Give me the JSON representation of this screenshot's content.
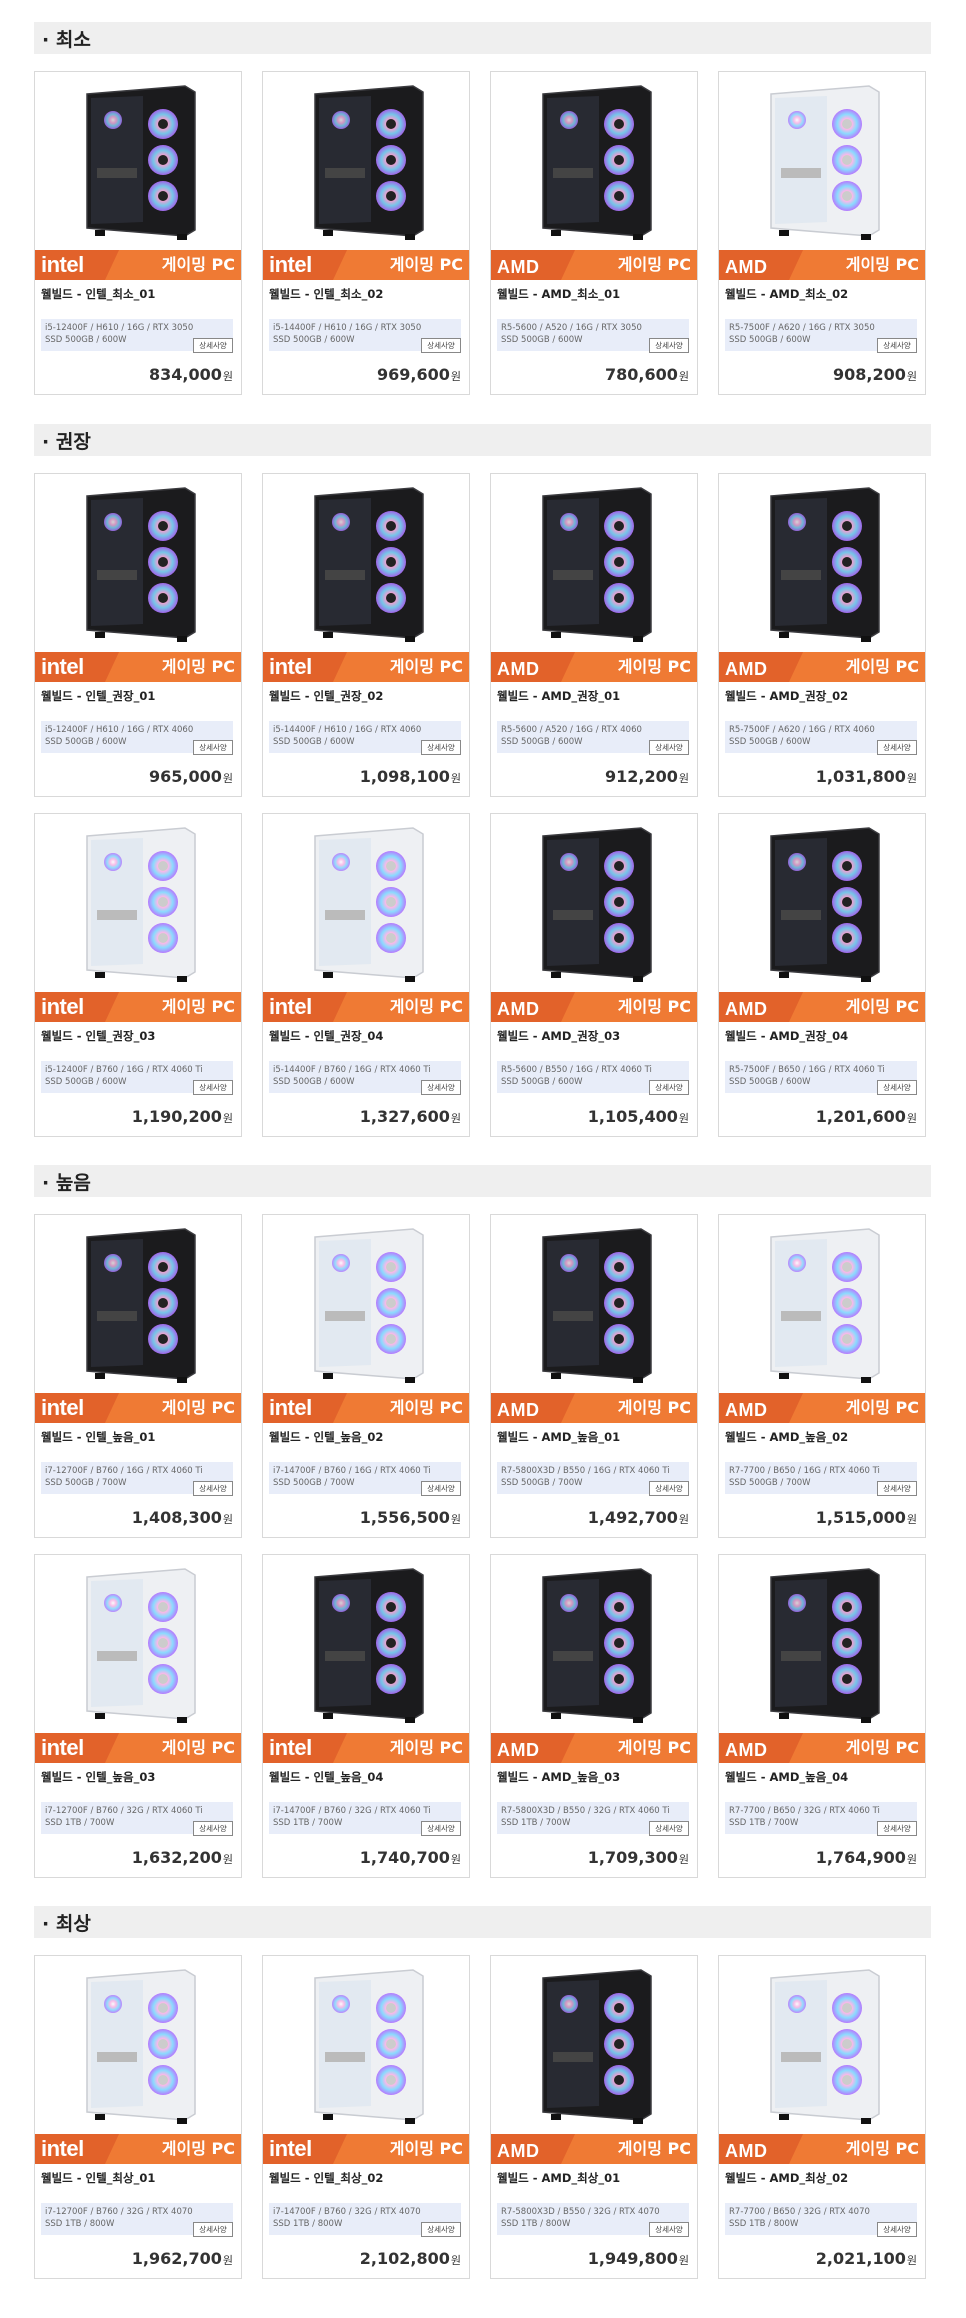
{
  "colors": {
    "banner": "#ef7a34",
    "banner_dark": "#e2622a",
    "spec_bg": "#e8edf9"
  },
  "common": {
    "tag": "게이밍 PC",
    "detail_label": "상세사양",
    "won": "원"
  },
  "sections": [
    {
      "title": "· 최소",
      "products": [
        {
          "brand": "intel",
          "name": "웰빌드 - 인텔_최소_01",
          "spec1": "i5-12400F / H610 / 16G / RTX 3050",
          "spec2": "SSD 500GB / 600W",
          "price": "834,000",
          "case": "black"
        },
        {
          "brand": "intel",
          "name": "웰빌드 - 인텔_최소_02",
          "spec1": "i5-14400F / H610 / 16G / RTX 3050",
          "spec2": "SSD 500GB / 600W",
          "price": "969,600",
          "case": "black"
        },
        {
          "brand": "AMD",
          "name": "웰빌드 - AMD_최소_01",
          "spec1": "R5-5600 / A520 / 16G / RTX 3050",
          "spec2": "SSD 500GB / 600W",
          "price": "780,600",
          "case": "black"
        },
        {
          "brand": "AMD",
          "name": "웰빌드 - AMD_최소_02",
          "spec1": "R5-7500F / A620 / 16G / RTX 3050",
          "spec2": "SSD 500GB / 600W",
          "price": "908,200",
          "case": "white"
        }
      ]
    },
    {
      "title": "· 권장",
      "products": [
        {
          "brand": "intel",
          "name": "웰빌드 - 인텔_권장_01",
          "spec1": "i5-12400F / H610 / 16G / RTX 4060",
          "spec2": "SSD 500GB / 600W",
          "price": "965,000",
          "case": "black"
        },
        {
          "brand": "intel",
          "name": "웰빌드 - 인텔_권장_02",
          "spec1": "i5-14400F / H610 / 16G / RTX 4060",
          "spec2": "SSD 500GB / 600W",
          "price": "1,098,100",
          "case": "black"
        },
        {
          "brand": "AMD",
          "name": "웰빌드 - AMD_권장_01",
          "spec1": "R5-5600 / A520 / 16G / RTX 4060",
          "spec2": "SSD 500GB / 600W",
          "price": "912,200",
          "case": "black"
        },
        {
          "brand": "AMD",
          "name": "웰빌드 - AMD_권장_02",
          "spec1": "R5-7500F / A620 / 16G / RTX 4060",
          "spec2": "SSD 500GB / 600W",
          "price": "1,031,800",
          "case": "black"
        },
        {
          "brand": "intel",
          "name": "웰빌드 - 인텔_권장_03",
          "spec1": "i5-12400F / B760 / 16G / RTX 4060 Ti",
          "spec2": "SSD 500GB / 600W",
          "price": "1,190,200",
          "case": "white"
        },
        {
          "brand": "intel",
          "name": "웰빌드 - 인텔_권장_04",
          "spec1": "i5-14400F / B760 / 16G / RTX 4060 Ti",
          "spec2": "SSD 500GB / 600W",
          "price": "1,327,600",
          "case": "white"
        },
        {
          "brand": "AMD",
          "name": "웰빌드 - AMD_권장_03",
          "spec1": "R5-5600 / B550 / 16G / RTX 4060 Ti",
          "spec2": "SSD 500GB / 600W",
          "price": "1,105,400",
          "case": "black"
        },
        {
          "brand": "AMD",
          "name": "웰빌드 - AMD_권장_04",
          "spec1": "R5-7500F / B650 / 16G / RTX 4060 Ti",
          "spec2": "SSD 500GB / 600W",
          "price": "1,201,600",
          "case": "black"
        }
      ]
    },
    {
      "title": "· 높음",
      "products": [
        {
          "brand": "intel",
          "name": "웰빌드 - 인텔_높음_01",
          "spec1": "i7-12700F / B760 / 16G / RTX 4060 Ti",
          "spec2": "SSD 500GB / 700W",
          "price": "1,408,300",
          "case": "black"
        },
        {
          "brand": "intel",
          "name": "웰빌드 - 인텔_높음_02",
          "spec1": "i7-14700F / B760 / 16G / RTX 4060 Ti",
          "spec2": "SSD 500GB / 700W",
          "price": "1,556,500",
          "case": "white"
        },
        {
          "brand": "AMD",
          "name": "웰빌드 - AMD_높음_01",
          "spec1": "R7-5800X3D / B550 / 16G / RTX 4060 Ti",
          "spec2": "SSD 500GB / 700W",
          "price": "1,492,700",
          "case": "black"
        },
        {
          "brand": "AMD",
          "name": "웰빌드 - AMD_높음_02",
          "spec1": "R7-7700 / B650 / 16G / RTX 4060 Ti",
          "spec2": "SSD 500GB / 700W",
          "price": "1,515,000",
          "case": "white"
        },
        {
          "brand": "intel",
          "name": "웰빌드 - 인텔_높음_03",
          "spec1": "i7-12700F / B760 / 32G / RTX 4060 Ti",
          "spec2": "SSD 1TB / 700W",
          "price": "1,632,200",
          "case": "white"
        },
        {
          "brand": "intel",
          "name": "웰빌드 - 인텔_높음_04",
          "spec1": "i7-14700F / B760 / 32G / RTX 4060 Ti",
          "spec2": "SSD 1TB / 700W",
          "price": "1,740,700",
          "case": "black"
        },
        {
          "brand": "AMD",
          "name": "웰빌드 - AMD_높음_03",
          "spec1": "R7-5800X3D / B550 / 32G / RTX 4060 Ti",
          "spec2": "SSD 1TB / 700W",
          "price": "1,709,300",
          "case": "black"
        },
        {
          "brand": "AMD",
          "name": "웰빌드 - AMD_높음_04",
          "spec1": "R7-7700 / B650 / 32G / RTX 4060 Ti",
          "spec2": "SSD 1TB / 700W",
          "price": "1,764,900",
          "case": "black"
        }
      ]
    },
    {
      "title": "· 최상",
      "products": [
        {
          "brand": "intel",
          "name": "웰빌드 - 인텔_최상_01",
          "spec1": "i7-12700F / B760 / 32G / RTX 4070",
          "spec2": "SSD 1TB / 800W",
          "price": "1,962,700",
          "case": "white"
        },
        {
          "brand": "intel",
          "name": "웰빌드 - 인텔_최상_02",
          "spec1": "i7-14700F / B760 / 32G / RTX 4070",
          "spec2": "SSD 1TB / 800W",
          "price": "2,102,800",
          "case": "white"
        },
        {
          "brand": "AMD",
          "name": "웰빌드 - AMD_최상_01",
          "spec1": "R7-5800X3D / B550 / 32G / RTX 4070",
          "spec2": "SSD 1TB / 800W",
          "price": "1,949,800",
          "case": "black"
        },
        {
          "brand": "AMD",
          "name": "웰빌드 - AMD_최상_02",
          "spec1": "R7-7700 / B650 / 32G / RTX 4070",
          "spec2": "SSD 1TB / 800W",
          "price": "2,021,100",
          "case": "white"
        }
      ]
    }
  ]
}
